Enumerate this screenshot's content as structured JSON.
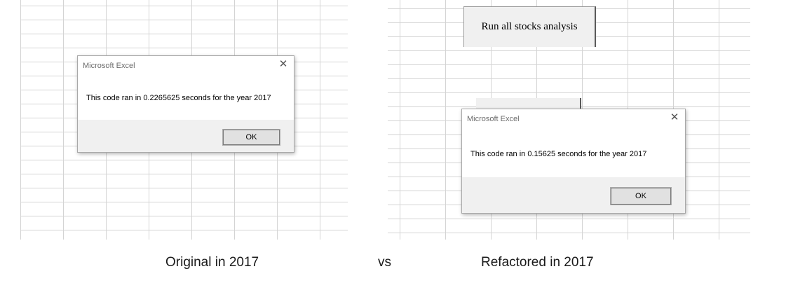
{
  "macro_button": {
    "label": "Run all stocks analysis"
  },
  "dialogs": [
    {
      "title": "Microsoft Excel",
      "close_glyph": "✕",
      "message": "This code ran in 0.2265625 seconds for the year 2017",
      "ok_label": "OK"
    },
    {
      "title": "Microsoft Excel",
      "close_glyph": "✕",
      "message": "This code ran in 0.15625 seconds for the year 2017",
      "ok_label": "OK"
    }
  ],
  "captions": {
    "left": "Original in 2017",
    "middle": "vs",
    "right": "Refactored in 2017"
  }
}
